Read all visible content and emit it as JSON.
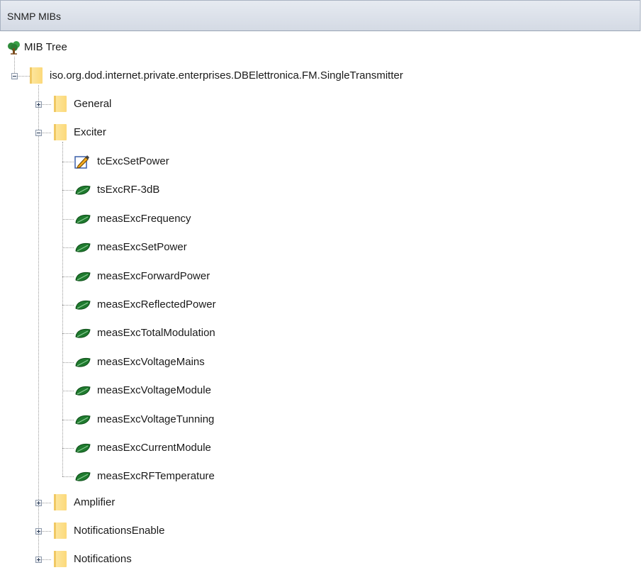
{
  "panel": {
    "title": "SNMP MIBs"
  },
  "tree": {
    "root_label": "MIB Tree",
    "module_label": "iso.org.dod.internet.private.enterprises.DBElettronica.FM.SingleTransmitter",
    "groups": [
      {
        "label": "General",
        "expanded": false
      },
      {
        "label": "Exciter",
        "expanded": true,
        "children": [
          {
            "label": "tcExcSetPower",
            "icon": "pencil-edit-icon"
          },
          {
            "label": "tsExcRF-3dB",
            "icon": "leaf-icon"
          },
          {
            "label": "measExcFrequency",
            "icon": "leaf-icon"
          },
          {
            "label": "measExcSetPower",
            "icon": "leaf-icon"
          },
          {
            "label": "measExcForwardPower",
            "icon": "leaf-icon"
          },
          {
            "label": "measExcReflectedPower",
            "icon": "leaf-icon"
          },
          {
            "label": "measExcTotalModulation",
            "icon": "leaf-icon"
          },
          {
            "label": "measExcVoltageMains",
            "icon": "leaf-icon"
          },
          {
            "label": "measExcVoltageModule",
            "icon": "leaf-icon"
          },
          {
            "label": "measExcVoltageTunning",
            "icon": "leaf-icon"
          },
          {
            "label": "measExcCurrentModule",
            "icon": "leaf-icon"
          },
          {
            "label": "measExcRFTemperature",
            "icon": "leaf-icon"
          }
        ]
      },
      {
        "label": "Amplifier",
        "expanded": false
      },
      {
        "label": "NotificationsEnable",
        "expanded": false
      },
      {
        "label": "Notifications",
        "expanded": false
      }
    ]
  },
  "colors": {
    "leaf": "#1f7a2e",
    "folder": "#fcd97a",
    "header": "#d9dee7"
  }
}
